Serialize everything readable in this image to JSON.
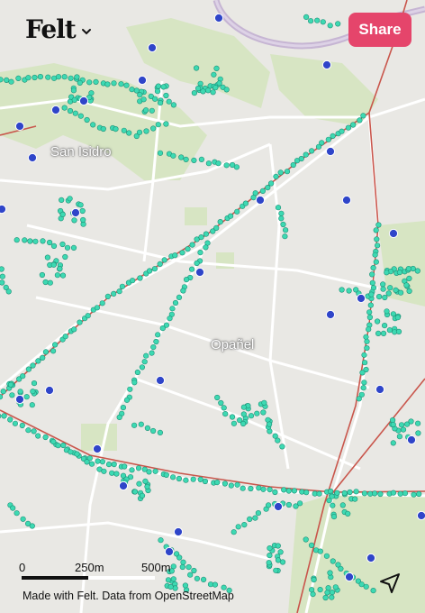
{
  "app": {
    "logo": "Felt",
    "share_label": "Share"
  },
  "map": {
    "places": [
      {
        "name": "San Isidro"
      },
      {
        "name": "Opañel"
      }
    ],
    "scale_labels": [
      "0",
      "250m",
      "500m"
    ],
    "attribution": "Made with Felt. Data from OpenStreetMap",
    "colors": {
      "background": "#e9e8e4",
      "park": "#d8e6c5",
      "river": "#c6b5d3",
      "rail": "#c9564c",
      "street": "#ffffff",
      "teal_point": "#3dd9b2",
      "blue_point": "#2f45c9",
      "accent": "#e5456b"
    },
    "icons": [
      "chevron-down-icon",
      "locate-arrow-icon"
    ]
  }
}
